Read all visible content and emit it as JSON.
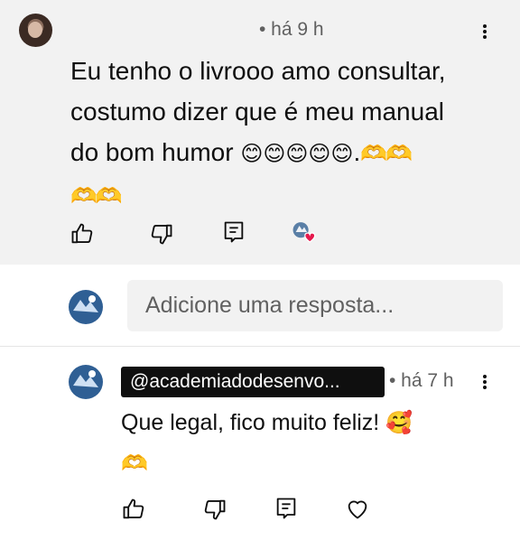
{
  "comment": {
    "timestamp": "• há 9 h",
    "text_line1": "Eu tenho o livrooo amo consultar,",
    "text_line2": "costumo dizer que é meu manual",
    "text_line3": "do bom humor",
    "emojis": "😊😊😊😊😊",
    "dot": ".",
    "heart_hands_1": "🫶🫶",
    "heart_hands_2": "🫶🫶",
    "icons": [
      "avatar",
      "more-vert-icon",
      "thumbs-up-icon",
      "thumbs-down-icon",
      "reply-icon",
      "creator-heart-icon"
    ]
  },
  "reply_input": {
    "placeholder": "Adicione uma resposta..."
  },
  "reply": {
    "handle": "@academiadodesenvo...",
    "timestamp": "• há 7 h",
    "text": "Que legal, fico muito feliz!",
    "emoji": "🥰",
    "heart_hands": "🫶",
    "icons": [
      "thumbs-up-icon",
      "thumbs-down-icon",
      "reply-icon",
      "heart-icon",
      "more-vert-icon"
    ]
  },
  "colors": {
    "card_background": "#f2f2f2",
    "text": "#0f0f0f",
    "secondary_text": "#606060",
    "heart": "#e5194d",
    "handle_badge": "#0f0f0f"
  }
}
